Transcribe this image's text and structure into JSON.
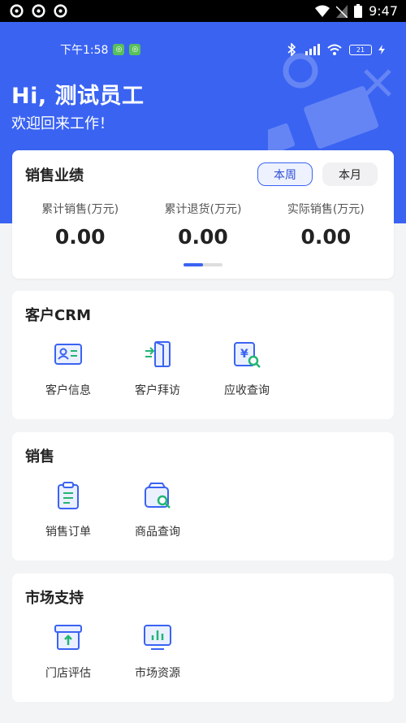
{
  "system_bar": {
    "time": "9:47"
  },
  "phone_status": {
    "time": "下午1:58",
    "battery": "21"
  },
  "header": {
    "greeting": "Hi, 测试员工",
    "welcome": "欢迎回来工作！"
  },
  "performance": {
    "title": "销售业绩",
    "toggles": [
      {
        "label": "本周",
        "active": true
      },
      {
        "label": "本月",
        "active": false
      }
    ],
    "stats": [
      {
        "label": "累计销售(万元)",
        "value": "0.00"
      },
      {
        "label": "累计退货(万元)",
        "value": "0.00"
      },
      {
        "label": "实际销售(万元)",
        "value": "0.00"
      }
    ]
  },
  "sections": [
    {
      "title": "客户CRM",
      "items": [
        {
          "label": "客户信息",
          "icon": "id-card-icon"
        },
        {
          "label": "客户拜访",
          "icon": "door-enter-icon"
        },
        {
          "label": "应收查询",
          "icon": "receivable-search-icon"
        }
      ]
    },
    {
      "title": "销售",
      "items": [
        {
          "label": "销售订单",
          "icon": "clipboard-icon"
        },
        {
          "label": "商品查询",
          "icon": "product-search-icon"
        }
      ]
    },
    {
      "title": "市场支持",
      "items": [
        {
          "label": "门店评估",
          "icon": "store-icon"
        },
        {
          "label": "市场资源",
          "icon": "monitor-chart-icon"
        }
      ]
    }
  ],
  "colors": {
    "primary": "#3a63f2",
    "background": "#f3f4f6",
    "card": "#ffffff"
  }
}
